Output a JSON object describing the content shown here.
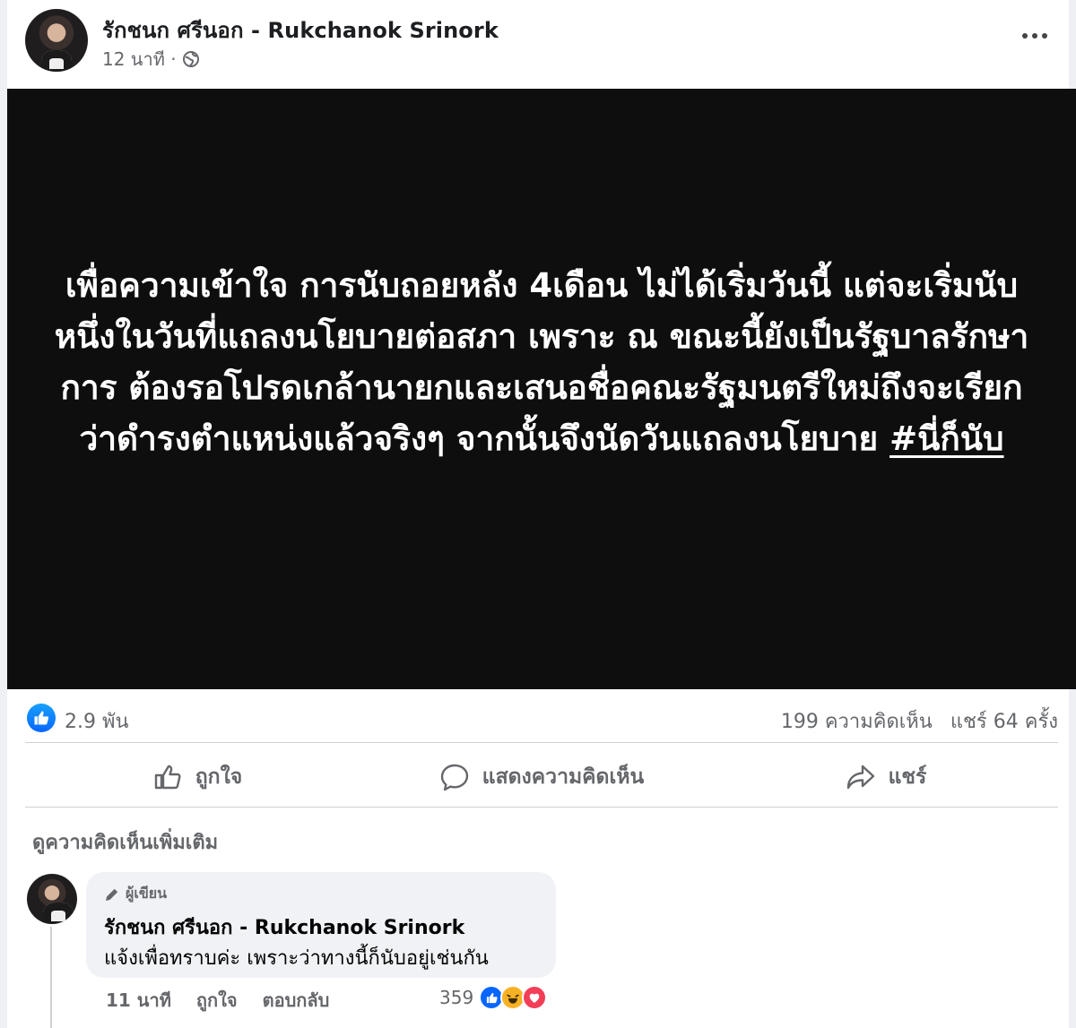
{
  "post": {
    "author": "รักชนก ศรีนอก - Rukchanok Srinork",
    "time": "12 นาที ·",
    "privacy_icon": "globe-icon",
    "more_icon": "more-options-icon",
    "image_text_main": "เพื่อความเข้าใจ การนับถอยหลัง 4เดือน ไม่ได้เริ่มวันนี้ แต่จะเริ่มนับหนึ่งในวันที่แถลงนโยบายต่อสภา เพราะ ณ ขณะนี้ยังเป็นรัฐบาลรักษาการ ต้องรอโปรดเกล้านายกและเสนอชื่อคณะรัฐมนตรีใหม่ถึงจะเรียกว่าดำรงตำแหน่งแล้วจริงๆ จากนั้นจึงนัดวันแถลงนโยบาย",
    "image_hashtag": "#นี่ก็นับ"
  },
  "stats": {
    "reactions": "2.9 พัน",
    "comments": "199 ความคิดเห็น",
    "shares": "แชร์ 64 ครั้ง"
  },
  "actions": {
    "like": "ถูกใจ",
    "comment": "แสดงความคิดเห็น",
    "share": "แชร์"
  },
  "view_more": "ดูความคิดเห็นเพิ่มเติม",
  "comment": {
    "badge": "ผู้เขียน",
    "name": "รักชนก ศรีนอก - Rukchanok Srinork",
    "text": "แจ้งเพื่อทราบค่ะ เพราะว่าทางนี้ก็นับอยู่เช่นกัน",
    "time": "11 นาที",
    "like": "ถูกใจ",
    "reply": "ตอบกลับ",
    "reaction_count": "359"
  },
  "colors": {
    "accent": "#0866ff",
    "secondary_text": "#65676b",
    "image_bg": "#0e0e0f"
  }
}
